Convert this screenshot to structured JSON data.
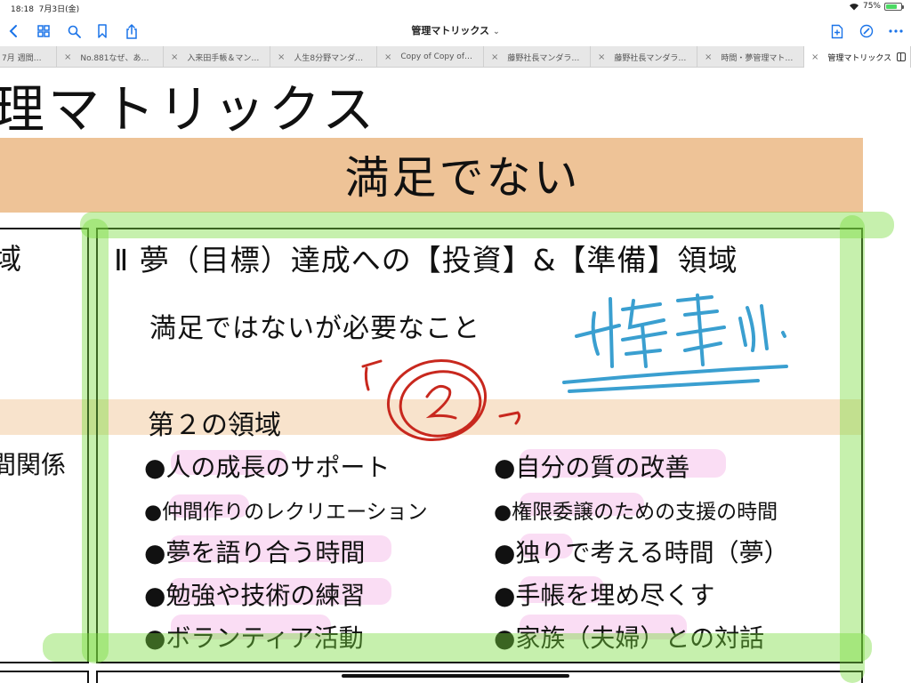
{
  "status": {
    "time": "18:18",
    "date": "7月3日(金)",
    "battery": "75%",
    "battery_level": 0.75
  },
  "toolbar": {
    "doc_title": "管理マトリックス",
    "chevron": "⌄"
  },
  "tabs": [
    {
      "label": "7月 週間…",
      "first": true
    },
    {
      "label": "No.881なぜ、あ…"
    },
    {
      "label": "入来田手帳＆マン…"
    },
    {
      "label": "人生8分野マンダ…"
    },
    {
      "label": "Copy of Copy of…"
    },
    {
      "label": "藤野社長マンダラ…"
    },
    {
      "label": "藤野社長マンダラ…"
    },
    {
      "label": "時間・夢管理マト…"
    },
    {
      "label": "管理マトリックス",
      "active": true
    }
  ],
  "document": {
    "title": "理マトリックス",
    "top_band": "満足でない",
    "left_char": "域",
    "left_relation": "間関係",
    "region_heading": "Ⅱ 夢（目標）達成への【投資】&【準備】領域",
    "region_subtitle": "満足ではないが必要なこと",
    "region_label": "第２の領域",
    "items_left": [
      "●人の成長のサポート",
      "●仲間作りのレクリエーション",
      "●夢を語り合う時間",
      "●勉強や技術の練習",
      "●ボランティア活動"
    ],
    "items_right": [
      "●自分の質の改善",
      "●権限委譲のための支援の時間",
      "●独りで考える時間（夢）",
      "●手帳を埋め尽くす",
      "●家族（夫婦）との対話"
    ]
  },
  "colors": {
    "accent": "#1a73e8",
    "band_top": "#eec397",
    "band_mid": "#f8e3cc",
    "green_highlighter": "#78dc3c",
    "pink_highlighter": "#f096dc",
    "red_ink": "#c8281e",
    "blue_ink": "#3a9fd0"
  },
  "icons": [
    "back-chevron-icon",
    "grid-icon",
    "search-icon",
    "bookmark-icon",
    "share-icon",
    "add-page-icon",
    "pen-icon",
    "more-icon",
    "wifi-icon",
    "battery-icon",
    "split-view-icon"
  ]
}
